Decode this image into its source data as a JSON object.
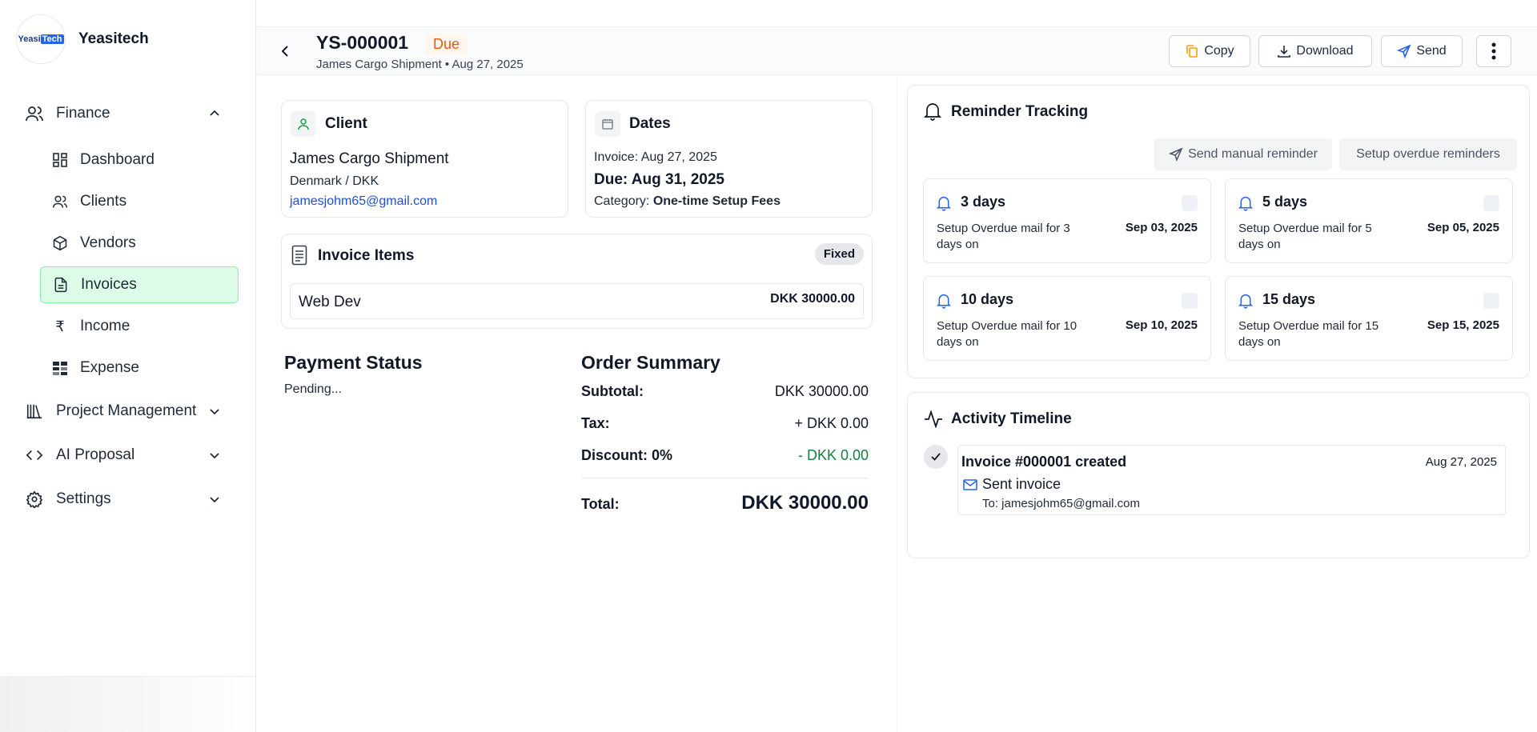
{
  "brand": {
    "name": "Yeasitech",
    "logo_text_a": "Yeasi",
    "logo_text_b": "Tech"
  },
  "sidebar": {
    "finance": {
      "label": "Finance"
    },
    "items": [
      {
        "label": "Dashboard"
      },
      {
        "label": "Clients"
      },
      {
        "label": "Vendors"
      },
      {
        "label": "Invoices"
      },
      {
        "label": "Income"
      },
      {
        "label": "Expense"
      }
    ],
    "project_management": {
      "label": "Project Management"
    },
    "ai_proposal": {
      "label": "AI Proposal"
    },
    "settings": {
      "label": "Settings"
    }
  },
  "header": {
    "invoice_number": "YS-000001",
    "status": "Due",
    "subtitle": "James Cargo Shipment • Aug 27, 2025",
    "copy_label": "Copy",
    "download_label": "Download",
    "send_label": "Send"
  },
  "client": {
    "title": "Client",
    "name": "James Cargo Shipment",
    "location": "Denmark / DKK",
    "email": "jamesjohm65@gmail.com"
  },
  "dates": {
    "title": "Dates",
    "invoice": "Invoice: Aug 27, 2025",
    "due": "Due: Aug 31, 2025",
    "category_label": "Category: ",
    "category_value": "One-time Setup Fees"
  },
  "invoice_items": {
    "title": "Invoice Items",
    "badge": "Fixed",
    "items": [
      {
        "name": "Web Dev",
        "amount": "DKK 30000.00"
      }
    ]
  },
  "payment_status": {
    "title": "Payment Status",
    "value": "Pending..."
  },
  "order_summary": {
    "title": "Order Summary",
    "subtotal_label": "Subtotal:",
    "subtotal_value": "DKK 30000.00",
    "tax_label": "Tax:",
    "tax_value": "+ DKK 0.00",
    "discount_label": "Discount: 0%",
    "discount_value": "- DKK 0.00",
    "total_label": "Total:",
    "total_value": "DKK 30000.00"
  },
  "reminders": {
    "title": "Reminder Tracking",
    "manual_label": "Send manual reminder",
    "setup_label": "Setup overdue reminders",
    "cards": [
      {
        "title": "3 days",
        "desc": "Setup Overdue mail for 3 days on",
        "date": "Sep 03, 2025"
      },
      {
        "title": "5 days",
        "desc": "Setup Overdue mail for 5 days on",
        "date": "Sep 05, 2025"
      },
      {
        "title": "10 days",
        "desc": "Setup Overdue mail for 10 days on",
        "date": "Sep 10, 2025"
      },
      {
        "title": "15 days",
        "desc": "Setup Overdue mail for 15 days on",
        "date": "Sep 15, 2025"
      }
    ]
  },
  "activity": {
    "title": "Activity Timeline",
    "entries": [
      {
        "title": "Invoice #000001 created",
        "date": "Aug 27, 2025",
        "event": "Sent invoice",
        "to": "To: jamesjohm65@gmail.com"
      }
    ]
  },
  "colors": {
    "accent_green": "#dcfce7",
    "due_orange": "#ea580c",
    "link_blue": "#1d4ed8",
    "discount_green": "#15803d"
  }
}
